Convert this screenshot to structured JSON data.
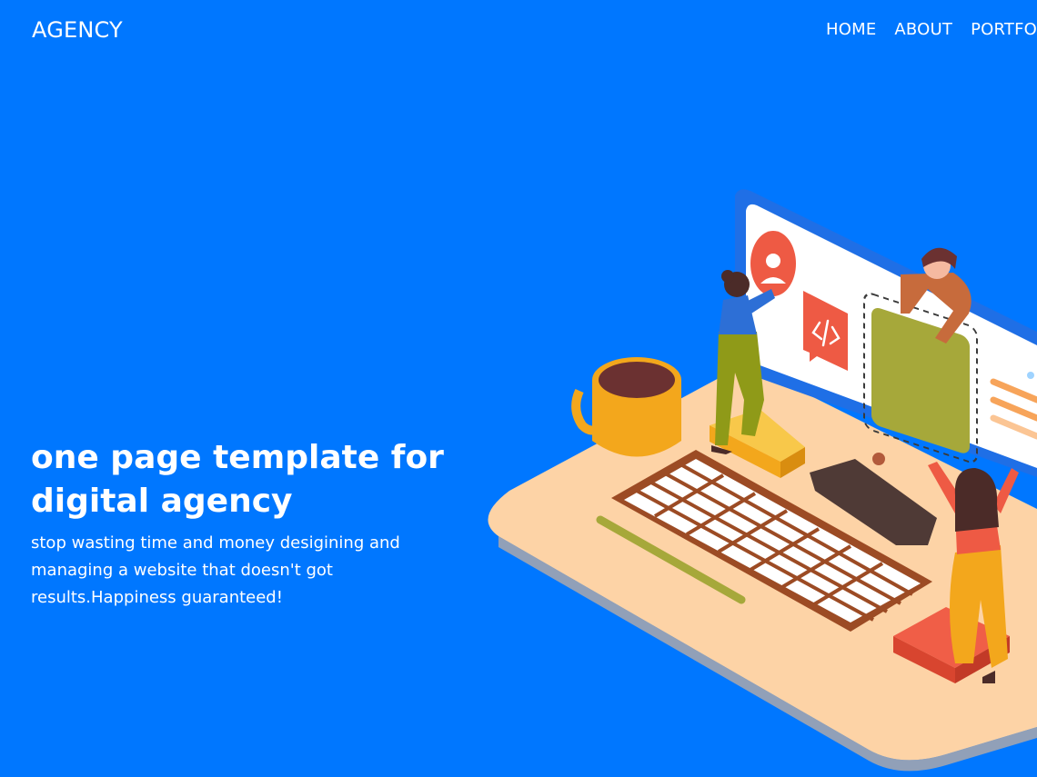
{
  "brand": {
    "name": "AGENCY"
  },
  "nav": {
    "items": [
      {
        "label": "HOME"
      },
      {
        "label": "ABOUT"
      },
      {
        "label": "PORTFOLIO"
      }
    ]
  },
  "hero": {
    "title": "one page template for digital agency",
    "subtitle": "stop wasting time and money desigining and managing a website that doesn't got results.Happiness guaranteed!"
  },
  "colors": {
    "background": "#0077ff",
    "text": "#ffffff",
    "desk": "#fdd3a6",
    "monitor_frame": "#1f6fe6",
    "accent_red": "#ee5a44",
    "accent_olive": "#a6a83a",
    "mug": "#f3a71c"
  },
  "illustration": {
    "icons": [
      "user-avatar-icon",
      "code-icon"
    ]
  }
}
